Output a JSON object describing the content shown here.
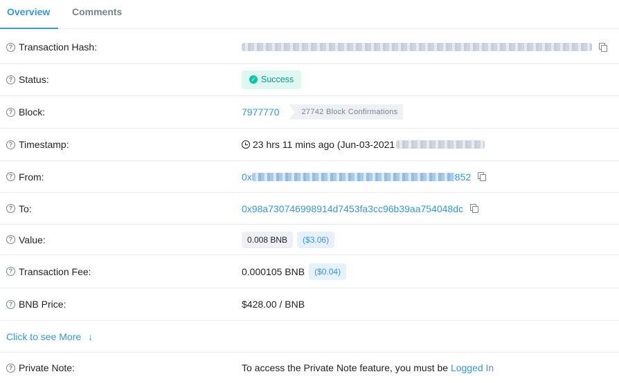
{
  "tabs": [
    {
      "label": "Overview",
      "active": true
    },
    {
      "label": "Comments",
      "active": false
    }
  ],
  "rows": {
    "tx_hash": {
      "label": "Transaction Hash:"
    },
    "status": {
      "label": "Status:",
      "value": "Success"
    },
    "block": {
      "label": "Block:",
      "value": "7977770",
      "confirmations": "27742 Block Confirmations"
    },
    "timestamp": {
      "label": "Timestamp:",
      "value": "23 hrs 11 mins ago (Jun-03-2021"
    },
    "from": {
      "label": "From:",
      "prefix": "0x",
      "suffix": "852"
    },
    "to": {
      "label": "To:",
      "value": "0x98a730746998914d7453fa3cc96b39aa754048dc"
    },
    "value": {
      "label": "Value:",
      "amount": "0.008 BNB",
      "usd": "($3.06)"
    },
    "fee": {
      "label": "Transaction Fee:",
      "amount": "0.000105 BNB",
      "usd": "($0.04)"
    },
    "price": {
      "label": "BNB Price:",
      "value": "$428.00 / BNB"
    },
    "more": {
      "label": "Click to see More"
    },
    "note": {
      "label": "Private Note:",
      "text": "To access the Private Note feature, you must be ",
      "link": "Logged In"
    }
  },
  "icons": {
    "help": "question-circle-icon",
    "copy": "copy-icon",
    "success": "check-circle-icon",
    "clock": "clock-icon",
    "more": "arrow-down-icon"
  },
  "colors": {
    "link": "#3498db",
    "success": "#00a186",
    "success_bg": "#dff6f1",
    "border": "#e7eaf3",
    "muted": "#77838f"
  }
}
